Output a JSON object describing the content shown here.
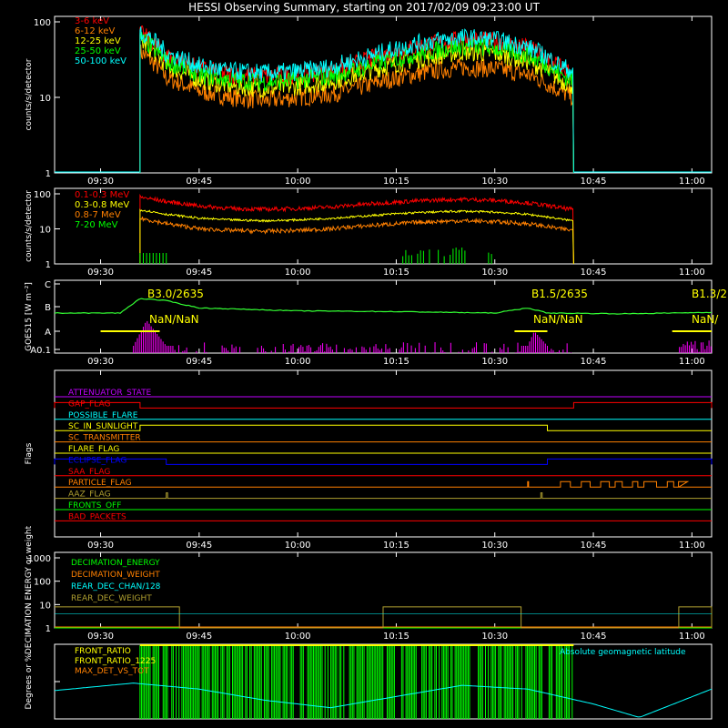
{
  "title": "HESSI Observing Summary, starting on 2017/02/09 09:23:00 UT",
  "colors": {
    "red": "#ff0000",
    "orange": "#ff8000",
    "yellow": "#ffff00",
    "green": "#00ff00",
    "cyan": "#00ffff",
    "magenta": "#ff00ff",
    "blue": "#0000ff",
    "olive": "#b0a030",
    "purple": "#c000ff",
    "lime": "#33ff33"
  },
  "chart_data": [
    {
      "id": "panel1",
      "type": "line",
      "ylabel": "counts/s/detector",
      "yscale": "log",
      "ylim": [
        1,
        100
      ],
      "yticks": [
        "1",
        "10",
        "100"
      ],
      "xlim_minutes": [
        0,
        100
      ],
      "xticks": [
        "09:30",
        "09:45",
        "10:00",
        "10:15",
        "10:30",
        "10:45",
        "11:00"
      ],
      "legend_placement": "top-left",
      "data_window": [
        "09:36",
        "10:42"
      ],
      "series": [
        {
          "name": "3-6 keV",
          "color": "#ff0000",
          "x": [
            "09:36",
            "09:40",
            "09:45",
            "09:50",
            "09:55",
            "10:00",
            "10:05",
            "10:10",
            "10:15",
            "10:20",
            "10:25",
            "10:30",
            "10:35",
            "10:40",
            "10:42"
          ],
          "values": [
            70,
            35,
            24,
            20,
            19,
            20,
            22,
            30,
            40,
            50,
            58,
            55,
            45,
            25,
            20
          ]
        },
        {
          "name": "6-12 keV",
          "color": "#ff8000",
          "x": [
            "09:36",
            "09:40",
            "09:45",
            "09:50",
            "09:55",
            "10:00",
            "10:05",
            "10:10",
            "10:15",
            "10:20",
            "10:25",
            "10:30",
            "10:35",
            "10:40",
            "10:42"
          ],
          "values": [
            40,
            18,
            12,
            10,
            9,
            10,
            11,
            14,
            18,
            22,
            25,
            24,
            20,
            12,
            10
          ]
        },
        {
          "name": "12-25 keV",
          "color": "#ffff00",
          "x": [
            "09:36",
            "09:40",
            "09:45",
            "09:50",
            "09:55",
            "10:00",
            "10:05",
            "10:10",
            "10:15",
            "10:20",
            "10:25",
            "10:30",
            "10:35",
            "10:40",
            "10:42"
          ],
          "values": [
            55,
            26,
            17,
            14,
            13,
            14,
            16,
            21,
            28,
            34,
            40,
            38,
            30,
            17,
            14
          ]
        },
        {
          "name": "25-50 keV",
          "color": "#00ff00",
          "x": [
            "09:36",
            "09:40",
            "09:45",
            "09:50",
            "09:55",
            "10:00",
            "10:05",
            "10:10",
            "10:15",
            "10:20",
            "10:25",
            "10:30",
            "10:35",
            "10:40",
            "10:42"
          ],
          "values": [
            60,
            30,
            20,
            17,
            16,
            17,
            19,
            25,
            33,
            40,
            48,
            45,
            36,
            20,
            17
          ]
        },
        {
          "name": "50-100 keV",
          "color": "#00ffff",
          "x": [
            "09:36",
            "09:40",
            "09:45",
            "09:50",
            "09:55",
            "10:00",
            "10:05",
            "10:10",
            "10:15",
            "10:20",
            "10:25",
            "10:30",
            "10:35",
            "10:40",
            "10:42"
          ],
          "values": [
            75,
            38,
            26,
            22,
            21,
            22,
            25,
            33,
            44,
            55,
            62,
            58,
            46,
            26,
            22
          ]
        }
      ]
    },
    {
      "id": "panel2",
      "type": "line",
      "ylabel": "counts/s/detector",
      "yscale": "log",
      "ylim": [
        1,
        100
      ],
      "yticks": [
        "1",
        "10",
        "100"
      ],
      "xticks": [
        "09:30",
        "09:45",
        "10:00",
        "10:15",
        "10:30",
        "10:45",
        "11:00"
      ],
      "legend_placement": "top-left",
      "series": [
        {
          "name": "0.1-0.3 MeV",
          "color": "#ff0000",
          "x": [
            "09:36",
            "09:40",
            "09:45",
            "09:50",
            "09:55",
            "10:00",
            "10:05",
            "10:10",
            "10:15",
            "10:20",
            "10:25",
            "10:30",
            "10:35",
            "10:40",
            "10:42"
          ],
          "values": [
            80,
            60,
            45,
            38,
            36,
            38,
            42,
            50,
            58,
            65,
            70,
            65,
            55,
            40,
            35
          ]
        },
        {
          "name": "0.3-0.8 MeV",
          "color": "#ffff00",
          "x": [
            "09:36",
            "09:40",
            "09:45",
            "09:50",
            "09:55",
            "10:00",
            "10:05",
            "10:10",
            "10:15",
            "10:20",
            "10:25",
            "10:30",
            "10:35",
            "10:40",
            "10:42"
          ],
          "values": [
            35,
            26,
            20,
            18,
            17,
            18,
            20,
            23,
            27,
            30,
            32,
            30,
            26,
            19,
            17
          ]
        },
        {
          "name": "0.8-7 MeV",
          "color": "#ff8000",
          "x": [
            "09:36",
            "09:40",
            "09:45",
            "09:50",
            "09:55",
            "10:00",
            "10:05",
            "10:10",
            "10:15",
            "10:20",
            "10:25",
            "10:30",
            "10:35",
            "10:40",
            "10:42"
          ],
          "values": [
            20,
            14,
            10,
            9,
            8.5,
            9,
            10,
            12,
            14,
            16,
            17,
            16,
            14,
            10,
            9
          ]
        },
        {
          "name": "7-20 MeV",
          "color": "#00ff00",
          "x": [
            "09:36",
            "09:40",
            "09:45",
            "09:50",
            "09:55",
            "10:00",
            "10:05",
            "10:10",
            "10:15",
            "10:20",
            "10:25",
            "10:30",
            "10:35",
            "10:40",
            "10:42"
          ],
          "values": [
            1.5,
            1,
            1,
            1,
            1,
            1,
            1,
            1,
            1.5,
            1.5,
            1.5,
            1,
            1,
            1,
            1
          ]
        }
      ]
    },
    {
      "id": "panel3",
      "type": "line",
      "ylabel": "GOES15 [W m⁻²]",
      "ytick_labels": [
        "A0.1",
        "A",
        "B",
        "C"
      ],
      "xticks": [
        "09:30",
        "09:45",
        "10:00",
        "10:15",
        "10:30",
        "10:45",
        "11:00"
      ],
      "annotations": [
        {
          "text": "B3.0/2635",
          "x": "09:37"
        },
        {
          "text": "NaN/NaN",
          "x": "09:38"
        },
        {
          "text": "B1.5/2635",
          "x": "10:35"
        },
        {
          "text": "NaN/NaN",
          "x": "10:36"
        },
        {
          "text": "B1.3/2",
          "x": "10:58"
        },
        {
          "text": "NaN/",
          "x": "10:59"
        }
      ],
      "series": [
        {
          "name": "GOES flux",
          "color": "#33ff33",
          "x": [
            "09:23",
            "09:33",
            "09:36",
            "09:40",
            "09:45",
            "10:00",
            "10:15",
            "10:30",
            "10:35",
            "10:38",
            "10:50",
            "11:03"
          ],
          "values": [
            0.55,
            0.55,
            0.75,
            0.72,
            0.62,
            0.58,
            0.57,
            0.55,
            0.62,
            0.55,
            0.54,
            0.56
          ]
        },
        {
          "name": "Activity",
          "color": "#ff00ff",
          "x": [
            "09:35",
            "09:37",
            "09:40",
            "10:35",
            "10:36",
            "10:38"
          ],
          "values": [
            0.1,
            0.45,
            0.1,
            0.1,
            0.3,
            0.1
          ]
        }
      ]
    },
    {
      "id": "panel4",
      "type": "step",
      "ylabel": "Flags",
      "xticks": [
        "09:30",
        "09:45",
        "10:00",
        "10:15",
        "10:30",
        "10:45",
        "11:00"
      ],
      "flags": [
        {
          "name": "ATTENUATOR_STATE",
          "color": "#c000ff",
          "on": []
        },
        {
          "name": "GAP_FLAG",
          "color": "#ff0000",
          "on": [
            [
              "09:23",
              "09:36"
            ],
            [
              "10:42",
              "11:03"
            ]
          ]
        },
        {
          "name": "POSSIBLE_FLARE",
          "color": "#00ffff",
          "on": []
        },
        {
          "name": "SC_IN_SUNLIGHT",
          "color": "#ffff00",
          "on": [
            [
              "09:36",
              "10:38"
            ]
          ]
        },
        {
          "name": "SC_TRANSMITTER",
          "color": "#ff8000",
          "on": []
        },
        {
          "name": "FLARE_FLAG",
          "color": "#ffff00",
          "on": []
        },
        {
          "name": "ECLIPSE_FLAG",
          "color": "#0000ff",
          "on": [
            [
              "09:23",
              "09:40"
            ],
            [
              "10:38",
              "11:03"
            ]
          ]
        },
        {
          "name": "SAA_FLAG",
          "color": "#ff0000",
          "on": []
        },
        {
          "name": "PARTICLE_FLAG",
          "color": "#ff8000",
          "on": [
            [
              "10:35",
              "10:35"
            ],
            [
              "10:40",
              "10:58"
            ]
          ]
        },
        {
          "name": "AAZ_FLAG",
          "color": "#b0a030",
          "on": [
            [
              "09:40",
              "09:40"
            ],
            [
              "10:37",
              "10:37"
            ]
          ]
        },
        {
          "name": "FRONTS_OFF",
          "color": "#00ff00",
          "on": []
        },
        {
          "name": "BAD_PACKETS",
          "color": "#ff0000",
          "on": []
        }
      ]
    },
    {
      "id": "panel5",
      "type": "step",
      "ylabel": "DECIMATION ENERGY or weight",
      "yscale": "log",
      "ylim": [
        1,
        1000
      ],
      "yticks": [
        "1",
        "10",
        "100",
        "1000"
      ],
      "xticks": [
        "09:30",
        "09:45",
        "10:00",
        "10:15",
        "10:30",
        "10:45",
        "11:00"
      ],
      "series": [
        {
          "name": "DECIMATION_ENERGY",
          "color": "#00ff00"
        },
        {
          "name": "DECIMATION_WEIGHT",
          "color": "#ff8000"
        },
        {
          "name": "REAR_DEC_CHAN/128",
          "color": "#00ffff"
        },
        {
          "name": "REAR_DEC_WEIGHT",
          "color": "#b0a030"
        }
      ]
    },
    {
      "id": "panel6",
      "type": "line",
      "ylabel": "Degrees or %",
      "xticks": [],
      "legend": [
        {
          "name": "FRONT_RATIO",
          "color": "#ffff00"
        },
        {
          "name": "FRONT_RATIO_1225",
          "color": "#ffff00"
        },
        {
          "name": "MAX_DET_VS_TOT",
          "color": "#ff8000"
        },
        {
          "name": "Absolute geomagnetic latitude",
          "color": "#00ffff"
        }
      ],
      "series": [
        {
          "name": "Absolute geomagnetic latitude",
          "color": "#00ffff",
          "x": [
            "09:23",
            "09:35",
            "09:45",
            "09:55",
            "10:05",
            "10:15",
            "10:25",
            "10:35",
            "10:45",
            "10:52",
            "11:03"
          ],
          "values": [
            38,
            48,
            40,
            25,
            15,
            30,
            45,
            40,
            20,
            2,
            40
          ]
        }
      ]
    }
  ]
}
